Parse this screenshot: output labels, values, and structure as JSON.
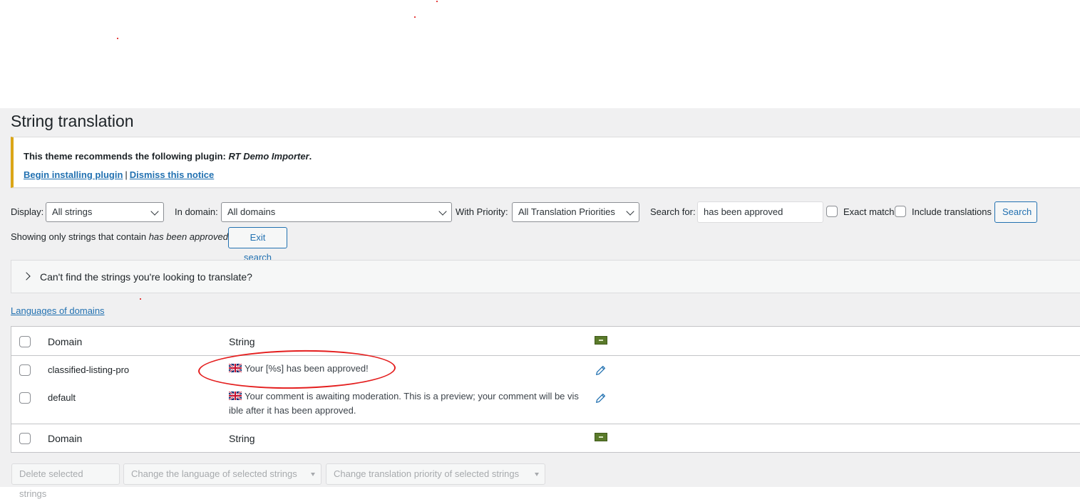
{
  "page": {
    "title": "String translation"
  },
  "notice": {
    "text_prefix": "This theme recommends the following plugin:",
    "plugin_name": "RT Demo Importer",
    "text_suffix": ".",
    "install_link": "Begin installing plugin",
    "separator": "|",
    "dismiss_link": "Dismiss this notice"
  },
  "filters": {
    "display_label": "Display:",
    "display_value": "All strings",
    "domain_label": "In domain:",
    "domain_value": "All domains",
    "priority_label": "With Priority:",
    "priority_value": "All Translation Priorities",
    "search_label": "Search for:",
    "search_value": "has been approved",
    "exact_match_label": "Exact match",
    "include_translations_label": "Include translations",
    "search_button": "Search"
  },
  "search_status": {
    "prefix": "Showing only strings that contain",
    "term": "has been approved",
    "exit_button": "Exit search"
  },
  "accordion": {
    "label": "Can't find the strings you're looking to translate?"
  },
  "languages_link": "Languages of domains",
  "table": {
    "header": {
      "domain": "Domain",
      "string": "String"
    },
    "rows": [
      {
        "domain": "classified-listing-pro",
        "string": "Your [%s] has been approved!"
      },
      {
        "domain": "default",
        "string_line1": "Your comment is awaiting moderation. This is a preview; your comment will be vis",
        "string_line2": "ible after it has been approved."
      }
    ],
    "footer": {
      "domain": "Domain",
      "string": "String"
    }
  },
  "bulk_actions": {
    "delete": "Delete selected strings",
    "change_language": "Change the language of selected strings",
    "change_priority": "Change translation priority of selected strings"
  },
  "colors": {
    "link": "#2271b1",
    "notice_accent": "#dba617",
    "annotation": "#e41e1e"
  }
}
